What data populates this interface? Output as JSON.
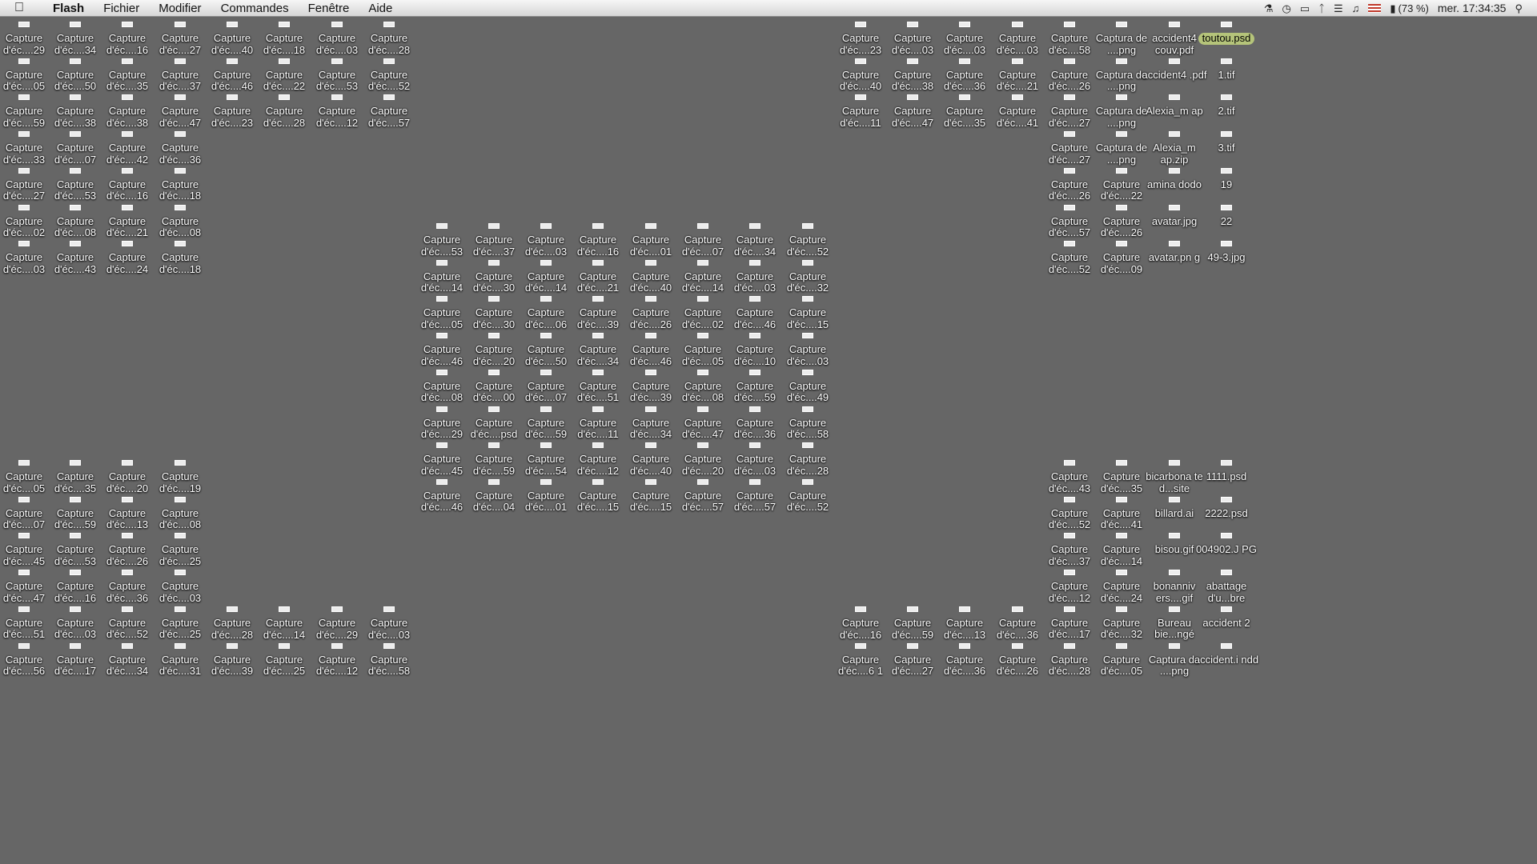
{
  "menubar": {
    "apple_icon": "apple-logo-icon",
    "menus": [
      "Flash",
      "Fichier",
      "Modifier",
      "Commandes",
      "Fenêtre",
      "Aide"
    ],
    "status_icons": [
      "script-icon",
      "time-machine-icon",
      "display-icon",
      "bluetooth-icon",
      "wifi-icon",
      "volume-icon",
      "us-flag-icon",
      "battery-icon",
      "spotlight-icon"
    ],
    "battery_text": "(73 %)",
    "clock": "mer. 17:34:35",
    "spotlight_glyph": "⚲"
  },
  "desktop": {
    "background_color": "#666666",
    "columns": [
      {
        "items": [
          {
            "label": "Capture d'éc....29"
          },
          {
            "label": "Capture d'éc....05"
          },
          {
            "label": "Capture d'éc....59"
          },
          {
            "label": "Capture d'éc....33"
          },
          {
            "label": "Capture d'éc....27"
          },
          {
            "label": "Capture d'éc....02"
          },
          {
            "label": "Capture d'éc....03"
          }
        ]
      },
      {
        "items": [
          {
            "label": "Capture d'éc....34"
          },
          {
            "label": "Capture d'éc....50"
          },
          {
            "label": "Capture d'éc....38"
          },
          {
            "label": "Capture d'éc....07"
          },
          {
            "label": "Capture d'éc....53"
          },
          {
            "label": "Capture d'éc....08"
          },
          {
            "label": "Capture d'éc....43"
          }
        ]
      },
      {
        "items": [
          {
            "label": "Capture d'éc....16"
          },
          {
            "label": "Capture d'éc....35"
          },
          {
            "label": "Capture d'éc....38"
          },
          {
            "label": "Capture d'éc....42"
          },
          {
            "label": "Capture d'éc....16"
          },
          {
            "label": "Capture d'éc....21"
          },
          {
            "label": "Capture d'éc....24"
          }
        ]
      },
      {
        "items": [
          {
            "label": "Capture d'éc....27"
          },
          {
            "label": "Capture d'éc....37"
          },
          {
            "label": "Capture d'éc....47"
          },
          {
            "label": "Capture d'éc....36"
          },
          {
            "label": "Capture d'éc....18"
          },
          {
            "label": "Capture d'éc....08"
          },
          {
            "label": "Capture d'éc....18"
          }
        ]
      },
      {
        "items": [
          {
            "label": "Capture d'éc....40"
          },
          {
            "label": "Capture d'éc....46"
          },
          {
            "label": "Capture d'éc....23"
          }
        ]
      },
      {
        "items": [
          {
            "label": "Capture d'éc....18"
          },
          {
            "label": "Capture d'éc....22"
          },
          {
            "label": "Capture d'éc....28"
          }
        ]
      },
      {
        "items": [
          {
            "label": "Capture d'éc....03"
          },
          {
            "label": "Capture d'éc....53"
          },
          {
            "label": "Capture d'éc....12"
          }
        ]
      },
      {
        "items": [
          {
            "label": "Capture d'éc....28"
          },
          {
            "label": "Capture d'éc....52"
          },
          {
            "label": "Capture d'éc....57"
          }
        ]
      },
      {
        "items": [
          {
            "label": "Capture d'éc....05"
          },
          {
            "label": "Capture d'éc....07"
          },
          {
            "label": "Capture d'éc....45"
          },
          {
            "label": "Capture d'éc....47"
          },
          {
            "label": "Capture d'éc....51"
          },
          {
            "label": "Capture d'éc....56"
          }
        ]
      },
      {
        "items": [
          {
            "label": "Capture d'éc....35"
          },
          {
            "label": "Capture d'éc....59"
          },
          {
            "label": "Capture d'éc....53"
          },
          {
            "label": "Capture d'éc....16"
          },
          {
            "label": "Capture d'éc....03"
          },
          {
            "label": "Capture d'éc....17"
          }
        ]
      },
      {
        "items": [
          {
            "label": "Capture d'éc....20"
          },
          {
            "label": "Capture d'éc....13"
          },
          {
            "label": "Capture d'éc....26"
          },
          {
            "label": "Capture d'éc....36"
          },
          {
            "label": "Capture d'éc....52"
          },
          {
            "label": "Capture d'éc....34"
          }
        ]
      },
      {
        "items": [
          {
            "label": "Capture d'éc....19"
          },
          {
            "label": "Capture d'éc....08"
          },
          {
            "label": "Capture d'éc....25"
          },
          {
            "label": "Capture d'éc....03"
          },
          {
            "label": "Capture d'éc....25"
          },
          {
            "label": "Capture d'éc....31"
          }
        ]
      },
      {
        "items": [
          {
            "label": "Capture d'éc....28"
          },
          {
            "label": "Capture d'éc....39"
          }
        ]
      },
      {
        "items": [
          {
            "label": "Capture d'éc....14"
          },
          {
            "label": "Capture d'éc....25"
          }
        ]
      },
      {
        "items": [
          {
            "label": "Capture d'éc....29"
          },
          {
            "label": "Capture d'éc....12"
          }
        ]
      },
      {
        "items": [
          {
            "label": "Capture d'éc....03"
          },
          {
            "label": "Capture d'éc....58"
          }
        ]
      },
      {
        "items": [
          {
            "label": "Capture d'éc....53"
          },
          {
            "label": "Capture d'éc....14"
          },
          {
            "label": "Capture d'éc....05"
          },
          {
            "label": "Capture d'éc....46"
          },
          {
            "label": "Capture d'éc....08"
          },
          {
            "label": "Capture d'éc....29"
          },
          {
            "label": "Capture d'éc....45"
          },
          {
            "label": "Capture d'éc....46"
          }
        ]
      },
      {
        "items": [
          {
            "label": "Capture d'éc....37"
          },
          {
            "label": "Capture d'éc....30"
          },
          {
            "label": "Capture d'éc....30"
          },
          {
            "label": "Capture d'éc....20"
          },
          {
            "label": "Capture d'éc....00"
          },
          {
            "label": "Capture d'éc....psd"
          },
          {
            "label": "Capture d'éc....59"
          },
          {
            "label": "Capture d'éc....04"
          }
        ]
      },
      {
        "items": [
          {
            "label": "Capture d'éc....03"
          },
          {
            "label": "Capture d'éc....14"
          },
          {
            "label": "Capture d'éc....06"
          },
          {
            "label": "Capture d'éc....50"
          },
          {
            "label": "Capture d'éc....07"
          },
          {
            "label": "Capture d'éc....59"
          },
          {
            "label": "Capture d'éc....54"
          },
          {
            "label": "Capture d'éc....01"
          }
        ]
      },
      {
        "items": [
          {
            "label": "Capture d'éc....16"
          },
          {
            "label": "Capture d'éc....21"
          },
          {
            "label": "Capture d'éc....39"
          },
          {
            "label": "Capture d'éc....34"
          },
          {
            "label": "Capture d'éc....51"
          },
          {
            "label": "Capture d'éc....11"
          },
          {
            "label": "Capture d'éc....12"
          },
          {
            "label": "Capture d'éc....15"
          }
        ]
      },
      {
        "items": [
          {
            "label": "Capture d'éc....01"
          },
          {
            "label": "Capture d'éc....40"
          },
          {
            "label": "Capture d'éc....26"
          },
          {
            "label": "Capture d'éc....46"
          },
          {
            "label": "Capture d'éc....39"
          },
          {
            "label": "Capture d'éc....34"
          },
          {
            "label": "Capture d'éc....40"
          },
          {
            "label": "Capture d'éc....15"
          }
        ]
      },
      {
        "items": [
          {
            "label": "Capture d'éc....07"
          },
          {
            "label": "Capture d'éc....14"
          },
          {
            "label": "Capture d'éc....02"
          },
          {
            "label": "Capture d'éc....05"
          },
          {
            "label": "Capture d'éc....08"
          },
          {
            "label": "Capture d'éc....47"
          },
          {
            "label": "Capture d'éc....20"
          },
          {
            "label": "Capture d'éc....57"
          }
        ]
      },
      {
        "items": [
          {
            "label": "Capture d'éc....34"
          },
          {
            "label": "Capture d'éc....03"
          },
          {
            "label": "Capture d'éc....46"
          },
          {
            "label": "Capture d'éc....10"
          },
          {
            "label": "Capture d'éc....59"
          },
          {
            "label": "Capture d'éc....36"
          },
          {
            "label": "Capture d'éc....03"
          },
          {
            "label": "Capture d'éc....57"
          }
        ]
      },
      {
        "items": [
          {
            "label": "Capture d'éc....52"
          },
          {
            "label": "Capture d'éc....32"
          },
          {
            "label": "Capture d'éc....15"
          },
          {
            "label": "Capture d'éc....03"
          },
          {
            "label": "Capture d'éc....49"
          },
          {
            "label": "Capture d'éc....58"
          },
          {
            "label": "Capture d'éc....28"
          },
          {
            "label": "Capture d'éc....52"
          }
        ]
      },
      {
        "items": [
          {
            "label": "Capture d'éc....23"
          },
          {
            "label": "Capture d'éc....40"
          },
          {
            "label": "Capture d'éc....11"
          }
        ]
      },
      {
        "items": [
          {
            "label": "Capture d'éc....03"
          },
          {
            "label": "Capture d'éc....38"
          },
          {
            "label": "Capture d'éc....47"
          }
        ]
      },
      {
        "items": [
          {
            "label": "Capture d'éc....03"
          },
          {
            "label": "Capture d'éc....36"
          },
          {
            "label": "Capture d'éc....35"
          }
        ]
      },
      {
        "items": [
          {
            "label": "Capture d'éc....03"
          },
          {
            "label": "Capture d'éc....21"
          },
          {
            "label": "Capture d'éc....41"
          }
        ]
      },
      {
        "items": [
          {
            "label": "Capture d'éc....58"
          },
          {
            "label": "Capture d'éc....26"
          },
          {
            "label": "Capture d'éc....27"
          },
          {
            "label": "Capture d'éc....27"
          },
          {
            "label": "Capture d'éc....26"
          },
          {
            "label": "Capture d'éc....57"
          },
          {
            "label": "Capture d'éc....52"
          }
        ]
      },
      {
        "items": [
          {
            "label": "Captura de ....png"
          },
          {
            "label": "Captura de ....png"
          },
          {
            "label": "Captura de ....png"
          },
          {
            "label": "Captura de ....png"
          },
          {
            "label": "Capture d'éc....22"
          },
          {
            "label": "Capture d'éc....26"
          },
          {
            "label": "Capture d'éc....09"
          }
        ]
      },
      {
        "items": [
          {
            "label": "accident4 couv.pdf"
          },
          {
            "label": "accident4 .pdf"
          },
          {
            "label": "Alexia_m ap"
          },
          {
            "label": "Alexia_m ap.zip"
          },
          {
            "label": "amina dodo"
          },
          {
            "label": "avatar.jpg"
          },
          {
            "label": "avatar.pn g"
          }
        ]
      },
      {
        "items": [
          {
            "label": "toutou.psd",
            "selected": true
          },
          {
            "label": "1.tif"
          },
          {
            "label": "2.tif"
          },
          {
            "label": "3.tif"
          },
          {
            "label": "19"
          },
          {
            "label": "22"
          },
          {
            "label": "49-3.jpg"
          }
        ]
      },
      {
        "items": [
          {
            "label": "Capture d'éc....16"
          },
          {
            "label": "Capture d'éc....6 1"
          }
        ]
      },
      {
        "items": [
          {
            "label": "Capture d'éc....59"
          },
          {
            "label": "Capture d'éc....27"
          }
        ]
      },
      {
        "items": [
          {
            "label": "Capture d'éc....13"
          },
          {
            "label": "Capture d'éc....36"
          }
        ]
      },
      {
        "items": [
          {
            "label": "Capture d'éc....36"
          },
          {
            "label": "Capture d'éc....26"
          }
        ]
      },
      {
        "items": [
          {
            "label": "Capture d'éc....43"
          },
          {
            "label": "Capture d'éc....52"
          },
          {
            "label": "Capture d'éc....37"
          },
          {
            "label": "Capture d'éc....12"
          },
          {
            "label": "Capture d'éc....17"
          },
          {
            "label": "Capture d'éc....28"
          }
        ]
      },
      {
        "items": [
          {
            "label": "Capture d'éc....35"
          },
          {
            "label": "Capture d'éc....41"
          },
          {
            "label": "Capture d'éc....14"
          },
          {
            "label": "Capture d'éc....24"
          },
          {
            "label": "Capture d'éc....32"
          },
          {
            "label": "Capture d'éc....05"
          }
        ]
      },
      {
        "items": [
          {
            "label": "bicarbona te d...site"
          },
          {
            "label": "billard.ai"
          },
          {
            "label": "bisou.gif"
          },
          {
            "label": "bonanniv ers....gif"
          },
          {
            "label": "Bureau bie...ngé"
          },
          {
            "label": "Captura de ....png"
          }
        ]
      },
      {
        "items": [
          {
            "label": "1111.psd"
          },
          {
            "label": "2222.psd"
          },
          {
            "label": "004902.J PG"
          },
          {
            "label": "abattage d'u...bre"
          },
          {
            "label": "accident 2"
          },
          {
            "label": "accident.i ndd"
          }
        ]
      }
    ]
  }
}
